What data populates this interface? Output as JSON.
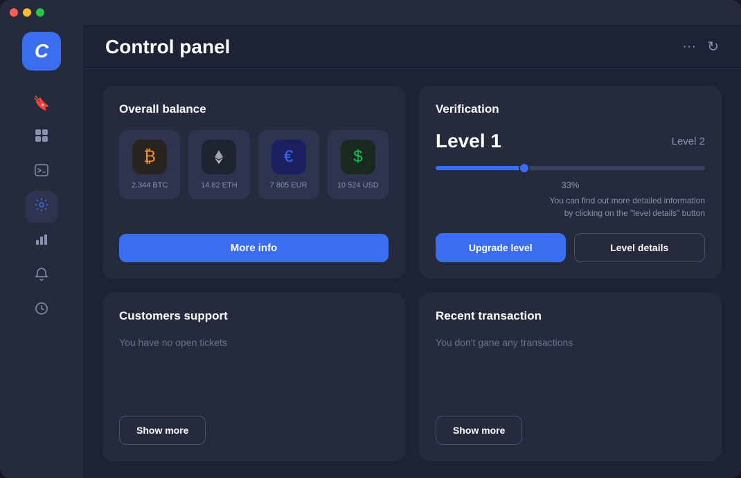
{
  "window": {
    "title": "Control panel"
  },
  "titlebar": {
    "dots": [
      "red",
      "yellow",
      "green"
    ]
  },
  "sidebar": {
    "logo": "C",
    "nav_items": [
      {
        "id": "bookmark",
        "icon": "🔖",
        "active": false
      },
      {
        "id": "dashboard",
        "icon": "▦",
        "active": false
      },
      {
        "id": "terminal",
        "icon": ">_",
        "active": false
      },
      {
        "id": "settings",
        "icon": "⚙",
        "active": true
      },
      {
        "id": "chart",
        "icon": "📊",
        "active": false
      },
      {
        "id": "bell",
        "icon": "🔔",
        "active": false
      },
      {
        "id": "history",
        "icon": "🕐",
        "active": false
      }
    ]
  },
  "topbar": {
    "title": "Control panel",
    "actions": {
      "more_icon": "···",
      "refresh_icon": "↻"
    }
  },
  "balance_card": {
    "title": "Overall balance",
    "cryptos": [
      {
        "symbol": "BTC",
        "amount": "2.344 BTC",
        "icon": "₿",
        "icon_class": "btc-icon"
      },
      {
        "symbol": "ETH",
        "amount": "14.82 ETH",
        "icon": "⟠",
        "icon_class": "eth-icon"
      },
      {
        "symbol": "EUR",
        "amount": "7 805 EUR",
        "icon": "€",
        "icon_class": "eur-icon"
      },
      {
        "symbol": "USD",
        "amount": "10 524 USD",
        "icon": "$",
        "icon_class": "usd-icon"
      }
    ],
    "more_info_label": "More info"
  },
  "verification_card": {
    "title": "Verification",
    "current_level": "Level 1",
    "next_level": "Level 2",
    "progress": 33,
    "progress_label": "33%",
    "description": "You can find out more detailed information\nby clicking on the \"level details\" button",
    "upgrade_label": "Upgrade level",
    "details_label": "Level details"
  },
  "support_card": {
    "title": "Customers support",
    "empty_text": "You have no open tickets",
    "show_more_label": "Show more"
  },
  "transaction_card": {
    "title": "Recent transaction",
    "empty_text": "You don't gane any transactions",
    "show_more_label": "Show more"
  }
}
